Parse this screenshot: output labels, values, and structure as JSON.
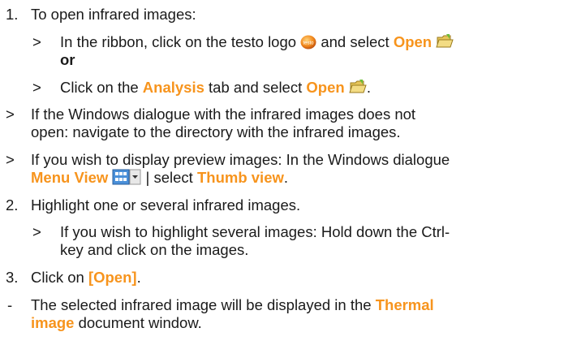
{
  "steps": {
    "s1": {
      "num": "1.",
      "text": "To open infrared images:"
    },
    "s1a": {
      "marker": ">",
      "pre": "In the ribbon, click on the testo logo",
      "mid": "and select",
      "hl": "Open",
      "or": "or"
    },
    "s1b": {
      "marker": ">",
      "pre": "Click on the",
      "hl1": "Analysis",
      "mid": "tab and select",
      "hl2": "Open",
      "end": "."
    },
    "r1": {
      "marker": ">",
      "line1": "If the Windows dialogue with the infrared images does not",
      "line2": "open: navigate to the directory with the infrared images."
    },
    "r2": {
      "marker": ">",
      "line1": "If you wish to display preview images: In the Windows dialogue",
      "hl1": "Menu View",
      "mid": "| select",
      "hl2": "Thumb view",
      "end": "."
    },
    "s2": {
      "num": "2.",
      "text": "Highlight one or several infrared images."
    },
    "s2a": {
      "marker": ">",
      "line1": "If you wish to highlight several images: Hold down the Ctrl-",
      "line2": "key and click on the images."
    },
    "s3": {
      "num": "3.",
      "pre": "Click on",
      "hl": "[Open]",
      "end": "."
    },
    "res": {
      "marker": "-",
      "pre": "The selected infrared image will be displayed in the",
      "hl1": "Thermal",
      "hl2": "image",
      "end": "document window."
    }
  },
  "icons": {
    "testo_logo": "testo-logo-icon",
    "folder": "open-folder-icon",
    "menu_view": "menu-view-icon"
  },
  "colors": {
    "highlight": "#f7941d"
  }
}
